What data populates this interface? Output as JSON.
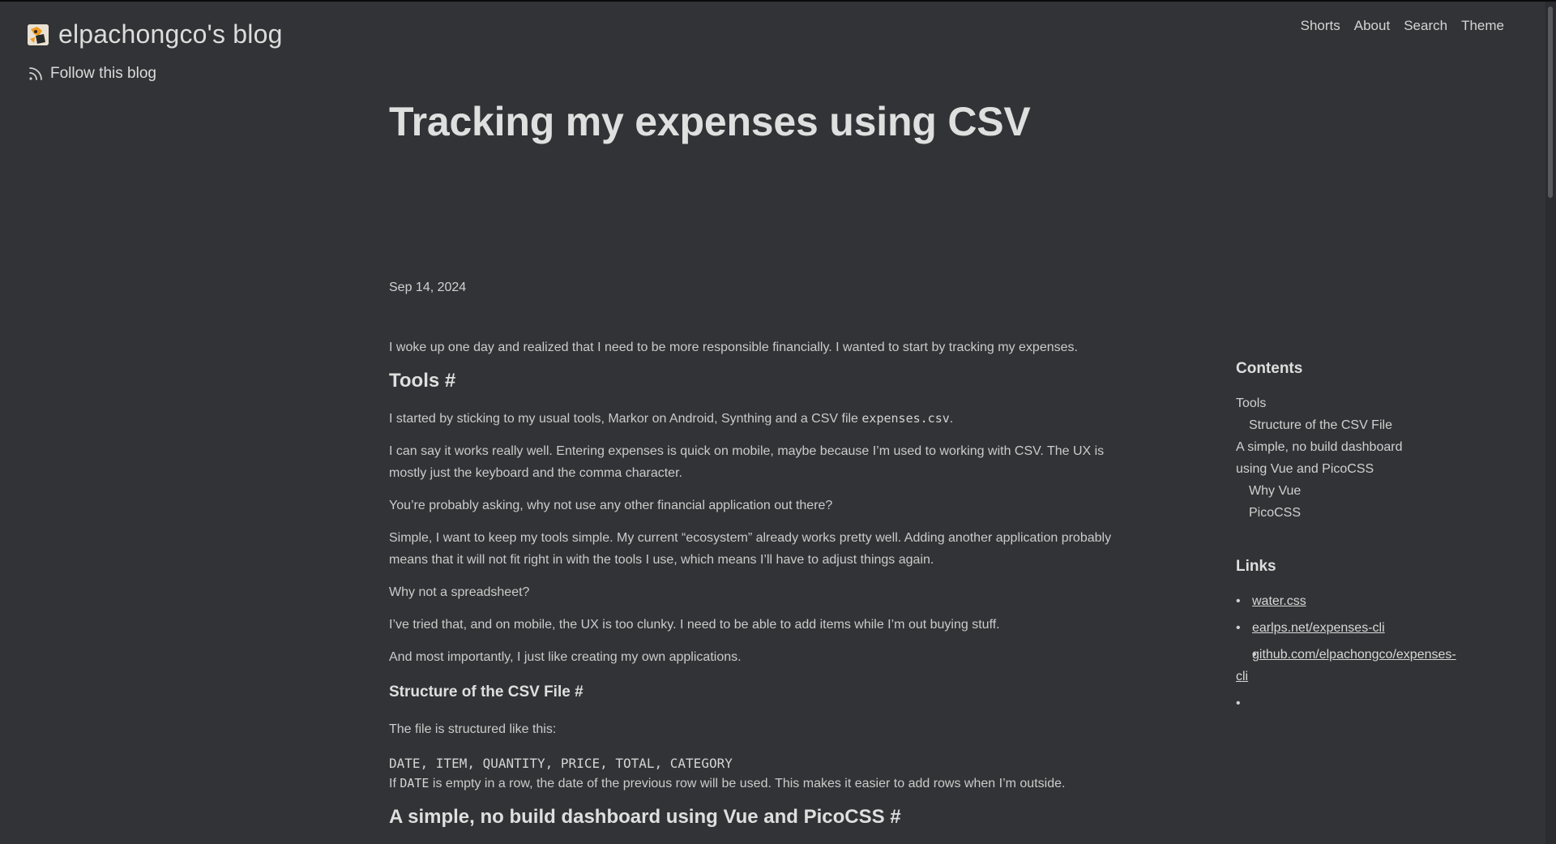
{
  "header": {
    "blog_title": "elpachongco's blog",
    "follow_label": "Follow this blog",
    "nav": [
      "Shorts",
      "About",
      "Search",
      "Theme"
    ]
  },
  "post": {
    "title": "Tracking my expenses using CSV",
    "date": "Sep 14, 2024",
    "intro": "I woke up one day and realized that I need to be more responsible financially. I wanted to start by tracking my expenses.",
    "h_tools": "Tools #",
    "p1_pre": "I started by sticking to my usual tools, Markor on Android, Synthing and a CSV file ",
    "p1_code": "expenses.csv",
    "p1_post": ".",
    "p2": "I can say it works really well. Entering expenses is quick on mobile, maybe because I’m used to working with CSV. The UX is mostly just the keyboard and the comma character.",
    "p3": "You’re probably asking, why not use any other financial application out there?",
    "p4": "Simple, I want to keep my tools simple. My current “ecosystem” already works pretty well. Adding another application probably means that it will not fit right in with the tools I use, which means I’ll have to adjust things again.",
    "p5": "Why not a spreadsheet?",
    "p6": "I’ve tried that, and on mobile, the UX is too clunky. I need to be able to add items while I’m out buying stuff.",
    "p7": "And most importantly, I just like creating my own applications.",
    "h_structure": "Structure of the CSV File #",
    "p8": "The file is structured like this:",
    "code_line": "DATE, ITEM, QUANTITY, PRICE, TOTAL, CATEGORY",
    "p9_pre": "If ",
    "p9_code": "DATE",
    "p9_post": " is empty in a row, the date of the previous row will be used. This makes it easier to add rows when I’m outside.",
    "h_dashboard": "A simple, no build dashboard using Vue and PicoCSS #"
  },
  "sidebar": {
    "contents_title": "Contents",
    "toc": {
      "tools": "Tools",
      "structure": "Structure of the CSV File",
      "dashboard": "A simple, no build dashboard using Vue and PicoCSS",
      "why_vue": "Why Vue",
      "picocss": "PicoCSS"
    },
    "links_title": "Links",
    "links": [
      "water.css",
      "earlps.net/expenses-cli",
      "github.com/elpachongco/expenses-cli"
    ]
  },
  "colors": {
    "background": "#323336",
    "text": "#cbcbcb",
    "heading": "#dfdfdf"
  },
  "icons": [
    "blog-logo-icon",
    "rss-icon"
  ]
}
